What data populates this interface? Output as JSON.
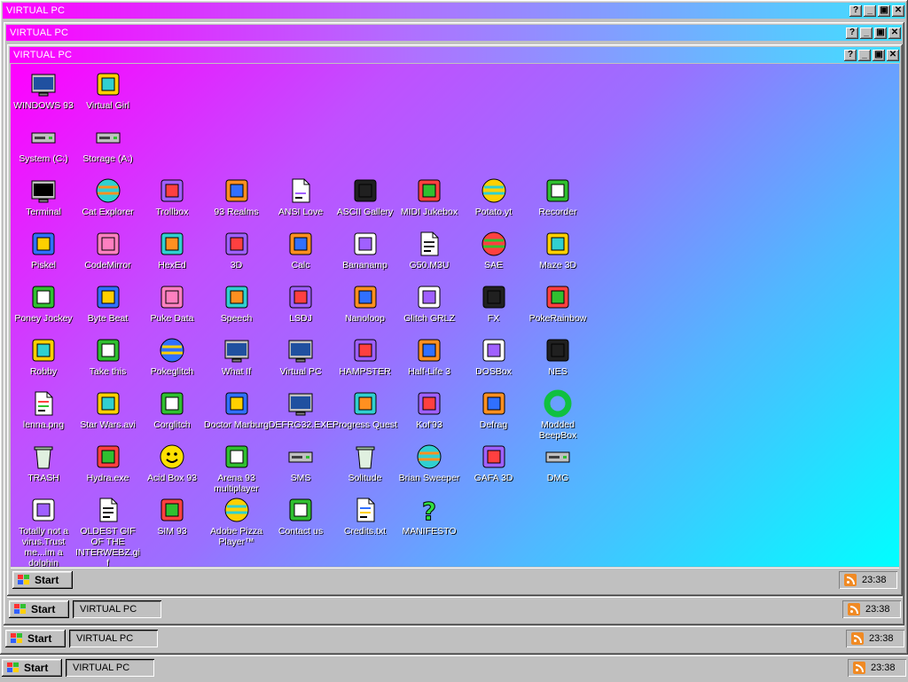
{
  "windows": [
    {
      "title": "VIRTUAL PC"
    },
    {
      "title": "VIRTUAL PC"
    },
    {
      "title": "VIRTUAL PC"
    }
  ],
  "title_buttons": {
    "help": "?",
    "minimize": "_",
    "maximize": "▣",
    "close": "✕"
  },
  "desktop": {
    "icons": [
      {
        "label": "WINDOWS 93",
        "icon": "computer-icon"
      },
      {
        "label": "Virtual Girl",
        "icon": "face-icon"
      },
      {
        "label": "System (C:)",
        "icon": "drive-icon"
      },
      {
        "label": "Storage (A:)",
        "icon": "floppy-icon"
      },
      {
        "label": "Terminal",
        "icon": "terminal-icon"
      },
      {
        "label": "Cat Explorer",
        "icon": "globe-icon"
      },
      {
        "label": "Trollbox",
        "icon": "chat-icon"
      },
      {
        "label": "93 Realms",
        "icon": "knight-icon"
      },
      {
        "label": "ANSI Love",
        "icon": "text-icon"
      },
      {
        "label": "ASCII Gallery",
        "icon": "numbers-icon"
      },
      {
        "label": "MIDI Jukebox",
        "icon": "piano-icon"
      },
      {
        "label": "Potato.yt",
        "icon": "potato-icon"
      },
      {
        "label": "Recorder",
        "icon": "microphone-icon"
      },
      {
        "label": "Piskel",
        "icon": "palette-icon"
      },
      {
        "label": "CodeMirror",
        "icon": "cat-icon"
      },
      {
        "label": "HexEd",
        "icon": "cube-icon"
      },
      {
        "label": "3D",
        "icon": "teapot-icon"
      },
      {
        "label": "Calc",
        "icon": "calculator-icon"
      },
      {
        "label": "Bananamp",
        "icon": "banana-icon"
      },
      {
        "label": "G50.M3U",
        "icon": "audio-file-icon"
      },
      {
        "label": "SAE",
        "icon": "ball-icon"
      },
      {
        "label": "Maze 3D",
        "icon": "maze-icon"
      },
      {
        "label": "Poney Jockey",
        "icon": "pony-icon"
      },
      {
        "label": "Byte Beat",
        "icon": "waveform-icon"
      },
      {
        "label": "Puke Data",
        "icon": "pd-icon"
      },
      {
        "label": "Speech",
        "icon": "face-speech-icon"
      },
      {
        "label": "LSDJ",
        "icon": "gameboy-icon"
      },
      {
        "label": "Nanoloop",
        "icon": "wave-lines-icon"
      },
      {
        "label": "Glitch GRLZ",
        "icon": "lips-icon"
      },
      {
        "label": "FX",
        "icon": "atom-icon"
      },
      {
        "label": "PokeRainbow",
        "icon": "characters-icon"
      },
      {
        "label": "Robby",
        "icon": "stick-figure-icon"
      },
      {
        "label": "Take this",
        "icon": "flame-icon"
      },
      {
        "label": "Pokeglitch",
        "icon": "pokeball-icon"
      },
      {
        "label": "What If",
        "icon": "window-grid-icon"
      },
      {
        "label": "Virtual PC",
        "icon": "window-cursor-icon"
      },
      {
        "label": "HAMPSTER",
        "icon": "owl-icon"
      },
      {
        "label": "Half-Life 3",
        "icon": "lambda-icon"
      },
      {
        "label": "DOSBox",
        "icon": "dosbox-icon"
      },
      {
        "label": "NES",
        "icon": "nes-icon"
      },
      {
        "label": "lenna.png",
        "icon": "image-file-icon"
      },
      {
        "label": "Star Wars.avi",
        "icon": "yoda-icon"
      },
      {
        "label": "Corglitch",
        "icon": "corgi-icon"
      },
      {
        "label": "Doctor Marburg",
        "icon": "doctor-icon"
      },
      {
        "label": "DEFRG32.EXE",
        "icon": "monitor-face-icon"
      },
      {
        "label": "Progress Quest",
        "icon": "swords-icon"
      },
      {
        "label": "Kof'93",
        "icon": "fighter-icon"
      },
      {
        "label": "Defrag",
        "icon": "defrag-icon"
      },
      {
        "label": "Modded BeepBox",
        "icon": "ring-icon"
      },
      {
        "label": "TRASH",
        "icon": "trash-icon"
      },
      {
        "label": "Hydra.exe",
        "icon": "dragon-icon"
      },
      {
        "label": "Acid Box 93",
        "icon": "smiley-icon"
      },
      {
        "label": "Arena 93 multiplayer",
        "icon": "cube-color-icon"
      },
      {
        "label": "SMS",
        "icon": "console-icon"
      },
      {
        "label": "Solitude",
        "icon": "jar-icon"
      },
      {
        "label": "Brian Sweeper",
        "icon": "mine-icon"
      },
      {
        "label": "GAFA 3D",
        "icon": "doomguy-icon"
      },
      {
        "label": "DMG",
        "icon": "gamecart-icon"
      },
      {
        "label": "Totally not a virus.Trust me...im a dolphin",
        "icon": "dolphin-icon"
      },
      {
        "label": "OLDEST GIF OF THE INTERWEBZ.gif",
        "icon": "gif-file-icon"
      },
      {
        "label": "SIM 93",
        "icon": "book-icon"
      },
      {
        "label": "Adobe Pizza Player™",
        "icon": "pizza-icon"
      },
      {
        "label": "Contact us",
        "icon": "mail-icon"
      },
      {
        "label": "Credits.txt",
        "icon": "text-file-icon"
      },
      {
        "label": "MANIFESTO",
        "icon": "question-icon"
      }
    ]
  },
  "taskbars": [
    {
      "start_label": "Start",
      "task_label": "",
      "clock": "23:38"
    },
    {
      "start_label": "Start",
      "task_label": "VIRTUAL PC",
      "clock": "23:38"
    },
    {
      "start_label": "Start",
      "task_label": "VIRTUAL PC",
      "clock": "23:38"
    },
    {
      "start_label": "Start",
      "task_label": "VIRTUAL PC",
      "clock": "23:38"
    }
  ],
  "colors": {
    "title_gradient_start": "#ff00ff",
    "title_gradient_end": "#40e0ff",
    "chrome": "#c0c0c0"
  }
}
